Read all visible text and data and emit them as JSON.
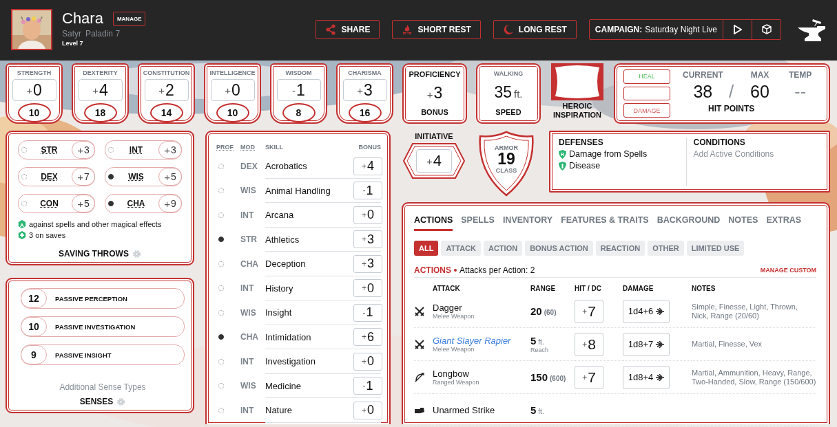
{
  "header": {
    "name": "Chara",
    "manage": "MANAGE",
    "race": "Satyr",
    "class": "Paladin 7",
    "level": "Level 7",
    "buttons": [
      {
        "kind": "share",
        "label": "SHARE"
      },
      {
        "kind": "short-rest",
        "label": "SHORT REST"
      },
      {
        "kind": "long-rest",
        "label": "LONG REST"
      }
    ],
    "campaign": {
      "label": "CAMPAIGN:",
      "value": "Saturday Night Live"
    }
  },
  "abilities": [
    {
      "name": "STRENGTH",
      "sign": "+",
      "value": "0",
      "score": "10"
    },
    {
      "name": "DEXTERITY",
      "sign": "+",
      "value": "4",
      "score": "18"
    },
    {
      "name": "CONSTITUTION",
      "sign": "+",
      "value": "2",
      "score": "14"
    },
    {
      "name": "INTELLIGENCE",
      "sign": "+",
      "value": "0",
      "score": "10"
    },
    {
      "name": "WISDOM",
      "sign": "-",
      "value": "1",
      "score": "8"
    },
    {
      "name": "CHARISMA",
      "sign": "+",
      "value": "3",
      "score": "16"
    }
  ],
  "proficiency": {
    "label": "PROFICIENCY",
    "sign": "+",
    "value": "3",
    "sublabel": "BONUS"
  },
  "speed": {
    "label": "WALKING",
    "value": "35",
    "unit": "ft.",
    "sublabel": "SPEED"
  },
  "inspiration": {
    "label": "HEROIC INSPIRATION",
    "on": false
  },
  "hit_points": {
    "heal": "HEAL",
    "damage": "DAMAGE",
    "current_label": "CURRENT",
    "current": "38",
    "separator": "/",
    "max_label": "MAX",
    "max": "60",
    "temp_label": "TEMP",
    "temp": "--",
    "title": "HIT POINTS"
  },
  "saving_throws": {
    "title": "SAVING THROWS",
    "items": [
      {
        "ability": "STR",
        "proficient": false,
        "sign": "+",
        "value": "3"
      },
      {
        "ability": "INT",
        "proficient": false,
        "sign": "+",
        "value": "3"
      },
      {
        "ability": "DEX",
        "proficient": false,
        "sign": "+",
        "value": "7"
      },
      {
        "ability": "WIS",
        "proficient": true,
        "sign": "+",
        "value": "5"
      },
      {
        "ability": "CON",
        "proficient": false,
        "sign": "+",
        "value": "5"
      },
      {
        "ability": "CHA",
        "proficient": true,
        "sign": "+",
        "value": "9"
      }
    ],
    "notes": [
      {
        "kind": "advantage",
        "badge": "A",
        "text": "against spells and other magical effects"
      },
      {
        "kind": "bonus",
        "text": "3 on saves"
      }
    ]
  },
  "senses": {
    "title": "SENSES",
    "link": "Additional Sense Types",
    "items": [
      {
        "value": "12",
        "label": "PASSIVE PERCEPTION"
      },
      {
        "value": "10",
        "label": "PASSIVE INVESTIGATION"
      },
      {
        "value": "9",
        "label": "PASSIVE INSIGHT"
      }
    ]
  },
  "skills": {
    "columns": [
      "PROF",
      "MOD",
      "SKILL",
      "BONUS"
    ],
    "rows": [
      {
        "proficient": false,
        "mod": "DEX",
        "name": "Acrobatics",
        "sign": "+",
        "value": "4"
      },
      {
        "proficient": false,
        "mod": "WIS",
        "name": "Animal Handling",
        "sign": "-",
        "value": "1"
      },
      {
        "proficient": false,
        "mod": "INT",
        "name": "Arcana",
        "sign": "+",
        "value": "0"
      },
      {
        "proficient": true,
        "mod": "STR",
        "name": "Athletics",
        "sign": "+",
        "value": "3"
      },
      {
        "proficient": false,
        "mod": "CHA",
        "name": "Deception",
        "sign": "+",
        "value": "3"
      },
      {
        "proficient": false,
        "mod": "INT",
        "name": "History",
        "sign": "+",
        "value": "0"
      },
      {
        "proficient": false,
        "mod": "WIS",
        "name": "Insight",
        "sign": "-",
        "value": "1"
      },
      {
        "proficient": true,
        "mod": "CHA",
        "name": "Intimidation",
        "sign": "+",
        "value": "6"
      },
      {
        "proficient": false,
        "mod": "INT",
        "name": "Investigation",
        "sign": "+",
        "value": "0"
      },
      {
        "proficient": false,
        "mod": "WIS",
        "name": "Medicine",
        "sign": "-",
        "value": "1"
      },
      {
        "proficient": false,
        "mod": "INT",
        "name": "Nature",
        "sign": "+",
        "value": "0"
      }
    ]
  },
  "initiative": {
    "label": "INITIATIVE",
    "sign": "+",
    "value": "4"
  },
  "armor": {
    "top": "ARMOR",
    "value": "19",
    "bottom": "CLASS"
  },
  "defenses": {
    "title": "DEFENSES",
    "items": [
      {
        "kind": "resistance",
        "badge": "R",
        "text": "Damage from Spells"
      },
      {
        "kind": "immunity",
        "text": "Disease"
      }
    ]
  },
  "conditions": {
    "title": "CONDITIONS",
    "placeholder": "Add Active Conditions"
  },
  "actions": {
    "tabs": [
      {
        "label": "ACTIONS",
        "selected": true
      },
      {
        "label": "SPELLS",
        "selected": false
      },
      {
        "label": "INVENTORY",
        "selected": false
      },
      {
        "label": "FEATURES & TRAITS",
        "selected": false
      },
      {
        "label": "BACKGROUND",
        "selected": false
      },
      {
        "label": "NOTES",
        "selected": false
      },
      {
        "label": "EXTRAS",
        "selected": false
      }
    ],
    "filters": [
      {
        "label": "ALL",
        "selected": true
      },
      {
        "label": "ATTACK",
        "selected": false
      },
      {
        "label": "ACTION",
        "selected": false
      },
      {
        "label": "BONUS ACTION",
        "selected": false
      },
      {
        "label": "REACTION",
        "selected": false
      },
      {
        "label": "OTHER",
        "selected": false
      },
      {
        "label": "LIMITED USE",
        "selected": false
      }
    ],
    "section": {
      "title": "ACTIONS",
      "subtitle": "Attacks per Action: 2",
      "manage": "MANAGE CUSTOM"
    },
    "columns": [
      "ATTACK",
      "RANGE",
      "HIT / DC",
      "DAMAGE",
      "NOTES"
    ],
    "rows": [
      {
        "kind": "melee",
        "name": "Dagger",
        "magic": false,
        "type": "Melee Weapon",
        "range": "20",
        "long_range": "(60)",
        "hit_sign": "+",
        "hit": "7",
        "damage": "1d4+6",
        "notes": "Simple, Finesse, Light, Thrown, Nick, Range (20/60)"
      },
      {
        "kind": "melee",
        "name": "Giant Slayer Rapier",
        "magic": true,
        "type": "Melee Weapon",
        "range": "5",
        "range_unit": "ft.",
        "range_note": "Reach",
        "hit_sign": "+",
        "hit": "8",
        "damage": "1d8+7",
        "notes": "Martial, Finesse, Vex"
      },
      {
        "kind": "ranged",
        "name": "Longbow",
        "magic": false,
        "type": "Ranged Weapon",
        "range": "150",
        "long_range": "(600)",
        "hit_sign": "+",
        "hit": "7",
        "damage": "1d8+4",
        "notes": "Martial, Ammunition, Heavy, Range, Two-Handed, Slow, Range (150/600)"
      },
      {
        "kind": "unarmed",
        "name": "Unarmed Strike",
        "magic": false,
        "range": "5",
        "range_unit": "ft."
      }
    ]
  }
}
